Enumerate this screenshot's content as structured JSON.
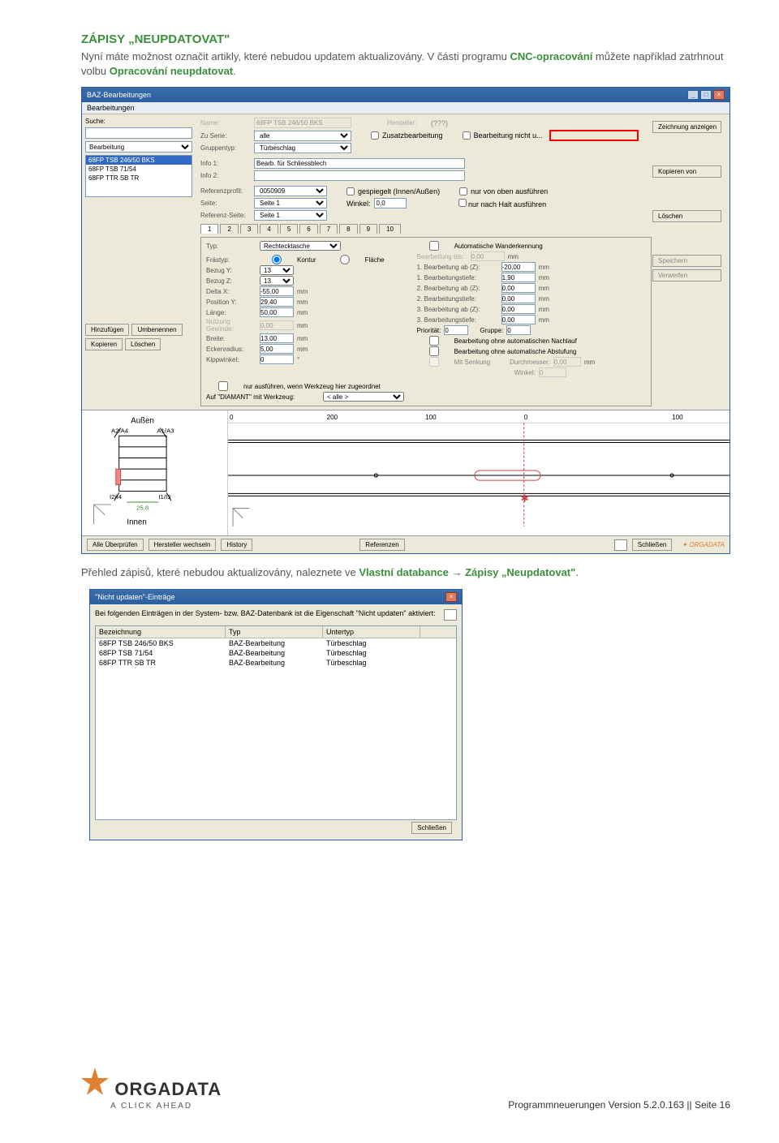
{
  "doc": {
    "heading": "ZÁPISY „NEUPDATOVAT\"",
    "para1_a": "Nyní máte možnost označit artikly, které nebudou updatem aktualizovány. V části programu ",
    "para1_b": " můžete například zatrhnout volbu ",
    "para1_c": ".",
    "link1": "CNC-opracování",
    "link2": "Opracování neupdatovat",
    "para2_a": "Přehled zápisů, které nebudou aktualizovány, naleznete ve ",
    "para2_b": " → ",
    "para2_c": ".",
    "link3": "Vlastní databance",
    "link4": "Zápisy „Neupdatovat\""
  },
  "baz": {
    "title": "BAZ-Bearbeitungen",
    "menubar": "Bearbeitungen",
    "window_min": "_",
    "window_max": "□",
    "window_close": "×",
    "search_lbl": "Suche:",
    "list_sel": "Bearbeitung",
    "list_items": [
      "68FP TSB 246/50 BKS",
      "68FP TSB 71/54",
      "68FP TTR SB TR"
    ],
    "left_btns": {
      "add": "Hinzufügen",
      "rename": "Umbenennen",
      "copy": "Kopieren",
      "delete": "Löschen"
    },
    "form": {
      "name_lbl": "Name:",
      "name_val": "68FP TSB 246/50 BKS",
      "hersteller_lbl": "Hersteller:",
      "hersteller_val": "(???)",
      "zuserie_lbl": "Zu Serie:",
      "zuserie_val": "alle",
      "gruppentyp_lbl": "Gruppentyp:",
      "gruppentyp_val": "Türbeschlag",
      "cb_zusatz": "Zusatzbearbeitung",
      "cb_nicht_up": "Bearbeitung nicht u...",
      "info1_lbl": "Info 1:",
      "info1_val": "Bearb. für Schliessblech",
      "info2_lbl": "Info 2:",
      "refprofil_lbl": "Referenzprofil:",
      "refprofil_val": "0050909",
      "cb_gespiegelt": "gespiegelt (Innen/Außen)",
      "cb_oben": "nur von oben ausführen",
      "cb_halt": "nur nach Halt ausführen",
      "seite_lbl": "Seite:",
      "seite_val": "Seite 1",
      "winkel_lbl": "Winkel:",
      "winkel_val": "0,0",
      "refseite_lbl": "Referenz-Seite:",
      "refseite_val": "Seite 1"
    },
    "tabs": [
      "1",
      "2",
      "3",
      "4",
      "5",
      "6",
      "7",
      "8",
      "9",
      "10"
    ],
    "panel": {
      "typ_lbl": "Typ:",
      "typ_val": "Rechtecktasche",
      "cb_autowand": "Automatische Wanderkennung",
      "bearb_bis_lbl": "Bearbeitung bis:",
      "bearb_bis_val": "0,00",
      "frastyp_lbl": "Frästyp:",
      "frastyp_opt1": "Kontur",
      "frastyp_opt2": "Fläche",
      "bezugy_lbl": "Bezug Y:",
      "bezugy_val": "13",
      "bezugz_lbl": "Bezug Z:",
      "bezugz_val": "13",
      "deltax_lbl": "Delta X:",
      "deltax_val": "-55,00",
      "posy_lbl": "Position Y:",
      "posy_val": "29,40",
      "lange_lbl": "Länge:",
      "lange_val": "50,00",
      "nutzg_lbl": "Nutzung Gewinde:",
      "nutzg_val": "0,00",
      "breite_lbl": "Breite:",
      "breite_val": "13,00",
      "ecken_lbl": "Eckenradius:",
      "ecken_val": "5,00",
      "kipp_lbl": "Kippwinkel:",
      "kipp_val": "0",
      "r1_lbl": "1. Bearbeitung ab (Z):",
      "r1_val": "-20,00",
      "r2_lbl": "1. Bearbeitungstiefe:",
      "r2_val": "1,90",
      "r3_lbl": "2. Bearbeitung ab (Z):",
      "r3_val": "0,00",
      "r4_lbl": "2. Bearbeitungstiefe:",
      "r4_val": "0,00",
      "r5_lbl": "3. Bearbeitung ab (Z):",
      "r5_val": "0,00",
      "r6_lbl": "3. Bearbeitungstiefe:",
      "r6_val": "0,00",
      "prio_lbl": "Priorität:",
      "prio_val": "0",
      "gruppe_lbl": "Gruppe:",
      "gruppe_val": "0",
      "cb_nachlauf": "Bearbeitung ohne automatischen Nachlauf",
      "cb_abstufung": "Bearbeitung ohne automatische Abstufung",
      "cb_senkung": "Mit Senkung",
      "dm_lbl": "Durchmesser:",
      "dm_val": "0,00",
      "senkwinkel_lbl": "Winkel:",
      "senkwinkel_val": "0",
      "cb_nurwerk": "nur ausführen, wenn Werkzeug hier zugeordnet",
      "auf_lbl": "Auf \"DIAMANT\" mit Werkzeug:",
      "auf_val": "< alle >",
      "mm": "mm"
    },
    "right_btns": {
      "zeichnung": "Zeichnung anzeigen",
      "kopieren_von": "Kopieren von",
      "loeschen": "Löschen",
      "speichern": "Speichern",
      "verwerfen": "Verwerfen"
    },
    "profile": {
      "aussen": "Außen",
      "a2a4": "A2/A4",
      "a1a3": "A1/A3",
      "i2i4": "I2/I4",
      "i1i3": "I1/I3",
      "innen": "Innen",
      "dim": "25,8",
      "ruler": {
        "r0": "0",
        "r200": "200",
        "r100a": "100",
        "r0b": "0",
        "r100b": "100"
      }
    },
    "footer": {
      "alle": "Alle Überprüfen",
      "hersteller": "Hersteller wechseln",
      "history": "History",
      "referenzen": "Referenzen",
      "schliessen": "Schließen",
      "orgadata": "ORGADATA"
    }
  },
  "dlg2": {
    "title": "\"Nicht updaten\"-Einträge",
    "window_close": "×",
    "desc": "Bei folgenden Einträgen in der System- bzw. BAZ-Datenbank ist die Eigenschaft \"Nicht updaten\" aktiviert:",
    "hdr": {
      "c1": "Bezeichnung",
      "c2": "Typ",
      "c3": "Untertyp"
    },
    "rows": [
      {
        "c1": "68FP TSB 246/50 BKS",
        "c2": "BAZ-Bearbeitung",
        "c3": "Türbeschlag"
      },
      {
        "c1": "68FP TSB 71/54",
        "c2": "BAZ-Bearbeitung",
        "c3": "Türbeschlag"
      },
      {
        "c1": "68FP TTR SB TR",
        "c2": "BAZ-Bearbeitung",
        "c3": "Türbeschlag"
      }
    ],
    "close_btn": "Schließen"
  },
  "page_footer": {
    "logo": "ORGADATA",
    "tagline": "A CLICK AHEAD",
    "pageinfo": "Programmneuerungen Version 5.2.0.163 || Seite 16"
  }
}
